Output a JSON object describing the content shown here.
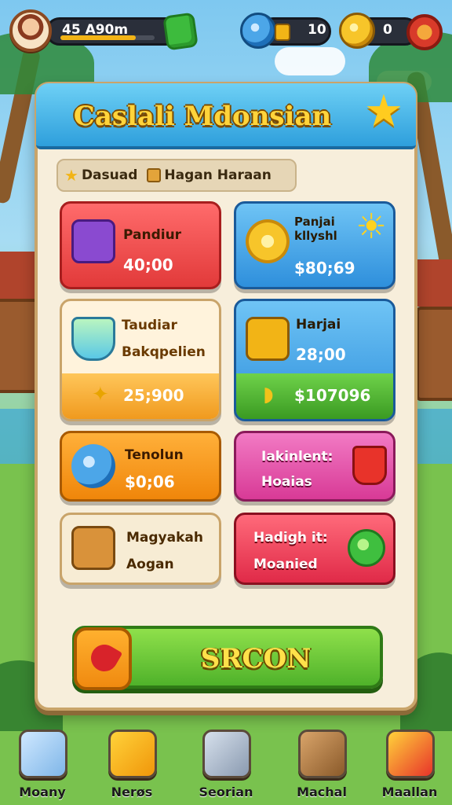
{
  "hud": {
    "score": "45 A90m",
    "score_progress": 0.8,
    "candy_count": "10",
    "coin_count": "0"
  },
  "panel": {
    "title": "Caslali Mdonsian",
    "filters": [
      {
        "label": "Dasuad",
        "icon": "star-icon"
      },
      {
        "label": "Hagan Haraan",
        "icon": "box-icon"
      }
    ]
  },
  "cards": [
    {
      "name": "Pandiur",
      "price": "40;00",
      "color": "#e84a4a",
      "icon": "gift-box-icon"
    },
    {
      "name": "Panjai\nkllyshl",
      "price": "$80;69",
      "color": "#3a9ee6",
      "icon": "gold-coin-icon"
    },
    {
      "name": "Taudiar\nBakqpelien",
      "price": "25;900",
      "color": "#f4b24a",
      "icon": "crystal-bowl-icon"
    },
    {
      "name": "Harjai",
      "price": "28;00",
      "sub_price": "$107096",
      "color": "#3a9ee6",
      "icon": "treasure-chest-icon"
    },
    {
      "name": "Tenolun",
      "price": "$0;06",
      "color": "#f49a1e",
      "icon": "blue-candy-icon"
    },
    {
      "name": "Iakinlent:\nHoaias",
      "price": "",
      "color": "#e64aa8",
      "icon": "fruit-bucket-icon"
    },
    {
      "name": "Magyakah\nAogan",
      "price": "",
      "color": "#f2e6cc",
      "icon": "wooden-chest-icon"
    },
    {
      "name": "Hadigh it:\nMoanied",
      "price": "",
      "color": "#f0385a",
      "icon": "green-orb-icon"
    }
  ],
  "action_button": "SRCON",
  "nav": [
    {
      "label": "Moany",
      "icon": "map-icon"
    },
    {
      "label": "Nerøs",
      "icon": "gift-icon"
    },
    {
      "label": "Seorian",
      "icon": "wolf-icon"
    },
    {
      "label": "Machal",
      "icon": "bear-icon"
    },
    {
      "label": "Maallan",
      "icon": "gift-plus-icon"
    }
  ]
}
